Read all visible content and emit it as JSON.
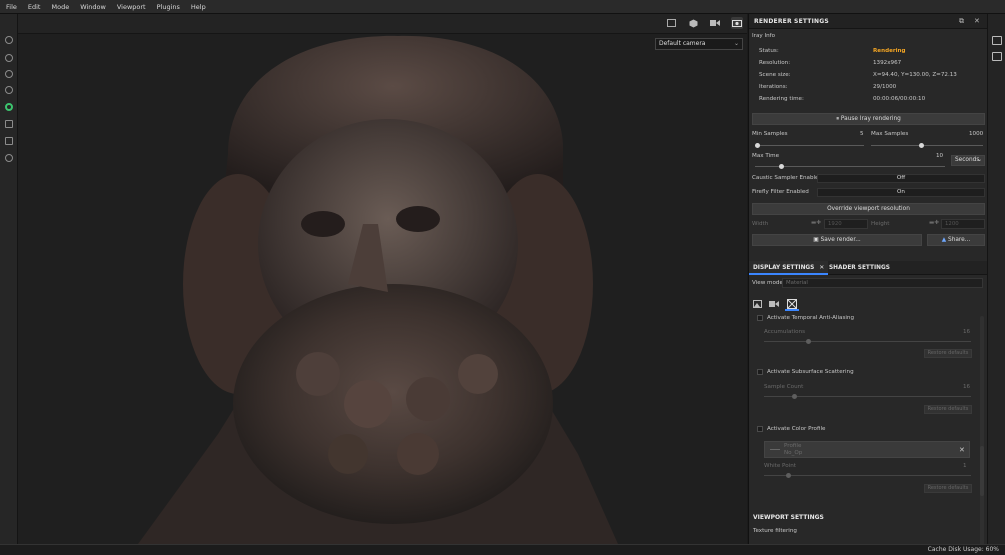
{
  "menu": [
    "File",
    "Edit",
    "Mode",
    "Window",
    "Viewport",
    "Plugins",
    "Help"
  ],
  "viewport": {
    "camera_select": "Default camera",
    "top_icons": [
      "frame-icon",
      "cube-icon",
      "video-camera-icon",
      "screenshot-camera-icon"
    ]
  },
  "left_toolbar_icons": [
    "settings-icon",
    "dot-icon",
    "lock-icon",
    "circle-icon",
    "render-sphere-icon",
    "photoshop-icon",
    "document-icon",
    "gear-icon"
  ],
  "renderer": {
    "title": "RENDERER SETTINGS",
    "section": "Iray Info",
    "info": [
      {
        "label": "Status:",
        "value": "Rendering"
      },
      {
        "label": "Resolution:",
        "value": "1392x967"
      },
      {
        "label": "Scene size:",
        "value": "X=94.40, Y=130.00, Z=72.13"
      },
      {
        "label": "Iterations:",
        "value": "29/1000"
      },
      {
        "label": "Rendering time:",
        "value": "00:00:06/00:00:10"
      }
    ],
    "pause_button": "Pause Iray rendering",
    "min_samples_label": "Min Samples",
    "min_samples_value": "5",
    "max_samples_label": "Max Samples",
    "max_samples_value": "1000",
    "max_time_label": "Max Time",
    "max_time_value": "10",
    "time_unit": "Seconds",
    "caustic_label": "Caustic Sampler Enabled",
    "caustic_value": "Off",
    "firefly_label": "Firefly Filter Enabled",
    "firefly_value": "On",
    "override_button": "Override viewport resolution",
    "width_label": "Width",
    "width_value": "1920",
    "height_label": "Height",
    "height_value": "1200",
    "save_button": "Save render...",
    "share_button": "Share...",
    "colors": {
      "status": "#f5a623",
      "accent": "#3b86ff"
    }
  },
  "display": {
    "tab_display": "DISPLAY SETTINGS",
    "tab_shader": "SHADER SETTINGS",
    "view_mode_label": "View mode",
    "view_mode_value": "Material",
    "temporal_aa": "Activate Temporal Anti-Aliasing",
    "accumulations_label": "Accumulations",
    "accumulations_value": "16",
    "restore_1": "Restore defaults",
    "sss": "Activate Subsurface Scattering",
    "sample_count_label": "Sample Count",
    "sample_count_value": "16",
    "restore_2": "Restore defaults",
    "color_profile": "Activate Color Profile",
    "profile_label": "Profile",
    "profile_value": "No_Op",
    "white_point_label": "White Point",
    "white_point_value": "1",
    "restore_3": "Restore defaults",
    "viewport_settings": "VIEWPORT SETTINGS",
    "texture_filtering": "Texture filtering"
  },
  "status_bar": {
    "cache_disk": "Cache Disk Usage:  60%"
  }
}
